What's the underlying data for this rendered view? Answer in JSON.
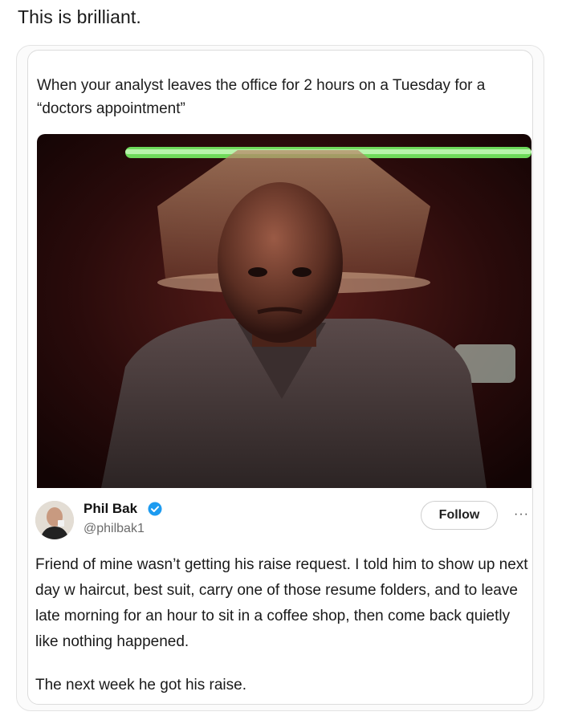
{
  "post": {
    "caption": "This is brilliant."
  },
  "meme": {
    "text": "When your analyst leaves the office for 2 hours on a Tuesday for a “doctors appointment”"
  },
  "tweet": {
    "author_name": "Phil Bak",
    "author_handle": "@philbak1",
    "verified": true,
    "follow_label": "Follow",
    "more_label": "···",
    "body_paragraph_1": "Friend of mine wasn’t getting his raise request. I told him to show up next day w haircut, best suit, carry one of those resume folders, and to leave late morning for an hour to sit in a coffee shop, then come back quietly like nothing happened.",
    "body_paragraph_2": "The next week he got his raise."
  },
  "colors": {
    "verified_badge": "#1d9bf0",
    "neon_green": "#7dff6a"
  },
  "icons": {
    "verified": "verified-badge-icon",
    "more": "more-options-icon"
  }
}
